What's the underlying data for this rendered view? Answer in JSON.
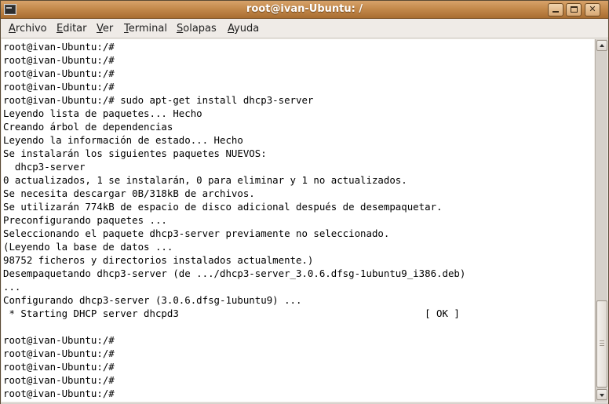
{
  "window": {
    "title": "root@ivan-Ubuntu: /",
    "minimize_label": "",
    "maximize_label": "",
    "close_label": "✕"
  },
  "menu": [
    {
      "mnemonic": "A",
      "rest": "rchivo"
    },
    {
      "mnemonic": "E",
      "rest": "ditar"
    },
    {
      "mnemonic": "V",
      "rest": "er"
    },
    {
      "mnemonic": "T",
      "rest": "erminal"
    },
    {
      "mnemonic": "S",
      "rest": "olapas"
    },
    {
      "mnemonic": "A",
      "rest": "yuda"
    }
  ],
  "terminal": {
    "lines": [
      "root@ivan-Ubuntu:/#",
      "root@ivan-Ubuntu:/#",
      "root@ivan-Ubuntu:/#",
      "root@ivan-Ubuntu:/#",
      "root@ivan-Ubuntu:/# sudo apt-get install dhcp3-server",
      "Leyendo lista de paquetes... Hecho",
      "Creando árbol de dependencias",
      "Leyendo la información de estado... Hecho",
      "Se instalarán los siguientes paquetes NUEVOS:",
      "  dhcp3-server",
      "0 actualizados, 1 se instalarán, 0 para eliminar y 1 no actualizados.",
      "Se necesita descargar 0B/318kB de archivos.",
      "Se utilizarán 774kB de espacio de disco adicional después de desempaquetar.",
      "Preconfigurando paquetes ...",
      "Seleccionando el paquete dhcp3-server previamente no seleccionado.",
      "(Leyendo la base de datos ...",
      "98752 ficheros y directorios instalados actualmente.)",
      "Desempaquetando dhcp3-server (de .../dhcp3-server_3.0.6.dfsg-1ubuntu9_i386.deb)",
      "...",
      "Configurando dhcp3-server (3.0.6.dfsg-1ubuntu9) ...",
      " * Starting DHCP server dhcpd3                                          [ OK ]",
      "",
      "root@ivan-Ubuntu:/#",
      "root@ivan-Ubuntu:/#",
      "root@ivan-Ubuntu:/#",
      "root@ivan-Ubuntu:/#",
      "root@ivan-Ubuntu:/#"
    ]
  }
}
